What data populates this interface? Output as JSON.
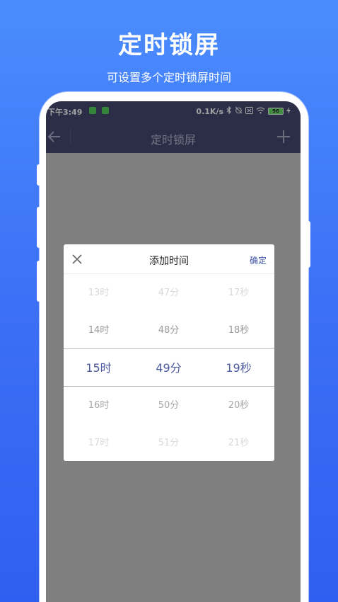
{
  "promo": {
    "title": "定时锁屏",
    "subtitle": "可设置多个定时锁屏时间"
  },
  "status_bar": {
    "time": "下午3:49",
    "network_speed": "0.1K/s",
    "battery_level": "96",
    "icons": [
      "app-notification-icon",
      "app-notification-icon",
      "bluetooth-icon",
      "alarm-off-icon",
      "sim-off-icon",
      "wifi-icon",
      "battery-icon",
      "charging-icon"
    ]
  },
  "app_bar": {
    "title": "定时锁屏",
    "back_icon": "arrow-left-icon",
    "add_icon": "plus-icon"
  },
  "dialog": {
    "title": "添加时间",
    "confirm_label": "确定",
    "close_icon": "close-icon",
    "hours": [
      "13时",
      "14时",
      "15时",
      "16时",
      "17时"
    ],
    "minutes": [
      "47分",
      "48分",
      "49分",
      "50分",
      "51分"
    ],
    "seconds": [
      "17秒",
      "18秒",
      "19秒",
      "20秒",
      "21秒"
    ],
    "selected": {
      "hour": "15时",
      "minute": "49分",
      "second": "19秒"
    }
  },
  "colors": {
    "background": "#3b6ef6",
    "app_bar": "#3b3d5f",
    "selected_text": "#4c5aa0",
    "accent": "#3f55a4"
  }
}
